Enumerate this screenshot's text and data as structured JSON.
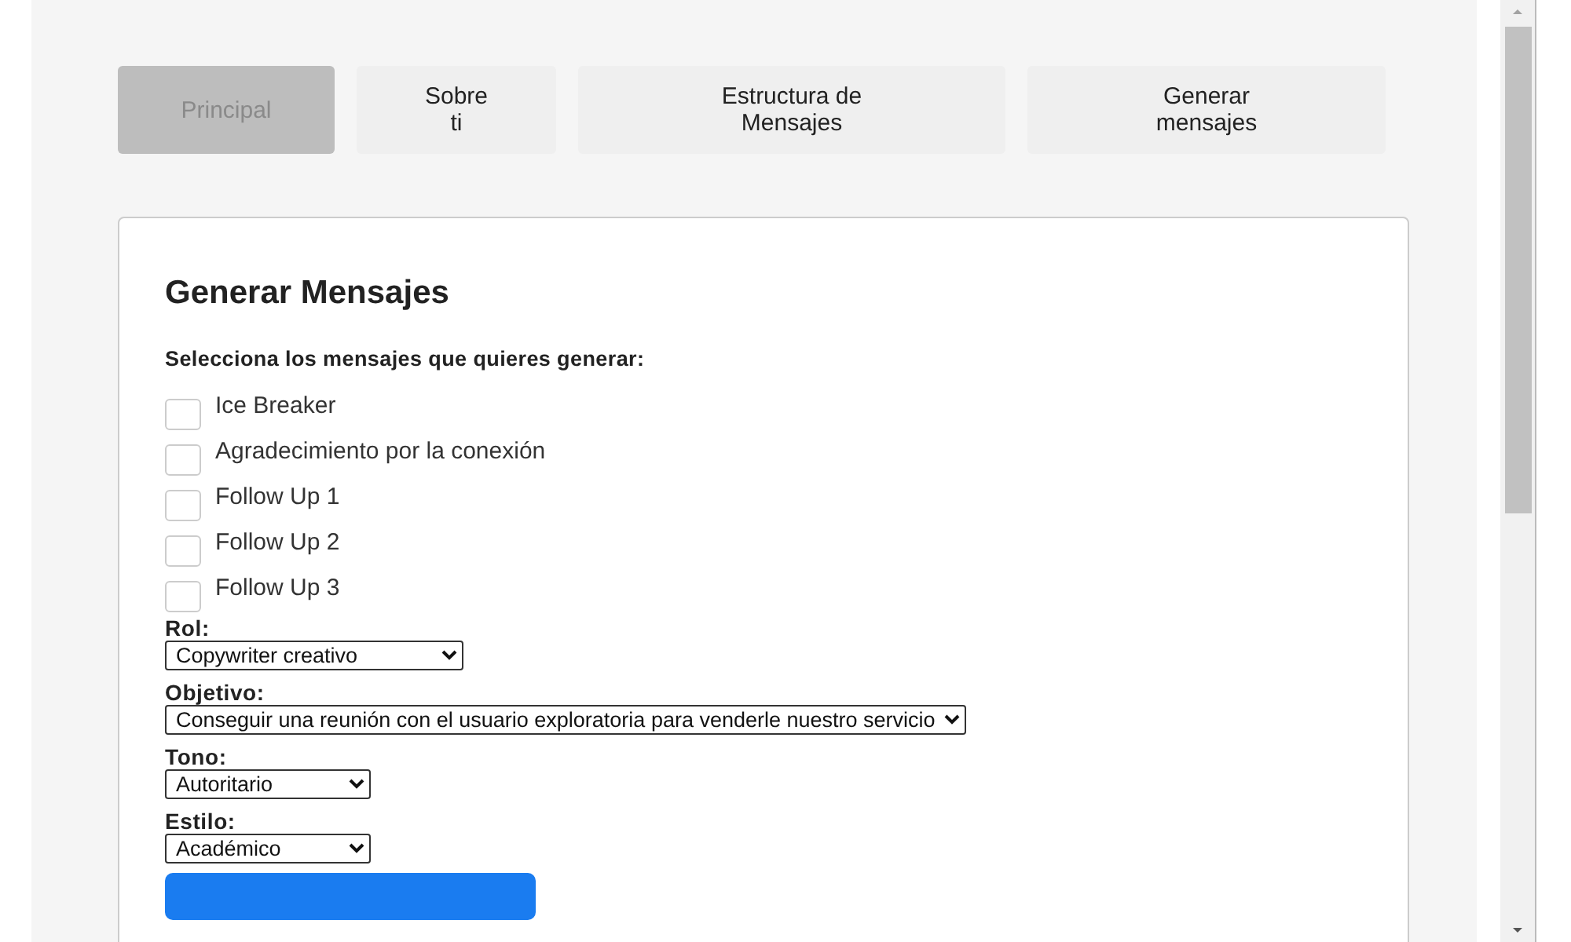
{
  "tabs": [
    {
      "label": "Principal",
      "selected": true
    },
    {
      "label": "Sobre\nti",
      "selected": false
    },
    {
      "label": "Estructura de\nMensajes",
      "selected": false
    },
    {
      "label": "Generar\nmensajes",
      "selected": false
    }
  ],
  "form": {
    "title": "Generar Mensajes",
    "prompt": "Selecciona los mensajes que quieres generar:",
    "messages": [
      {
        "label": "Ice Breaker",
        "checked": false
      },
      {
        "label": "Agradecimiento por la conexión",
        "checked": false
      },
      {
        "label": "Follow Up 1",
        "checked": false
      },
      {
        "label": "Follow Up 2",
        "checked": false
      },
      {
        "label": "Follow Up 3",
        "checked": false
      }
    ],
    "fields": [
      {
        "label": "Rol:",
        "value": "Copywriter creativo"
      },
      {
        "label": "Objetivo:",
        "value": "Conseguir una reunión con el usuario exploratoria para venderle nuestro servicio"
      },
      {
        "label": "Tono:",
        "value": "Autoritario"
      },
      {
        "label": "Estilo:",
        "value": "Académico"
      }
    ]
  }
}
